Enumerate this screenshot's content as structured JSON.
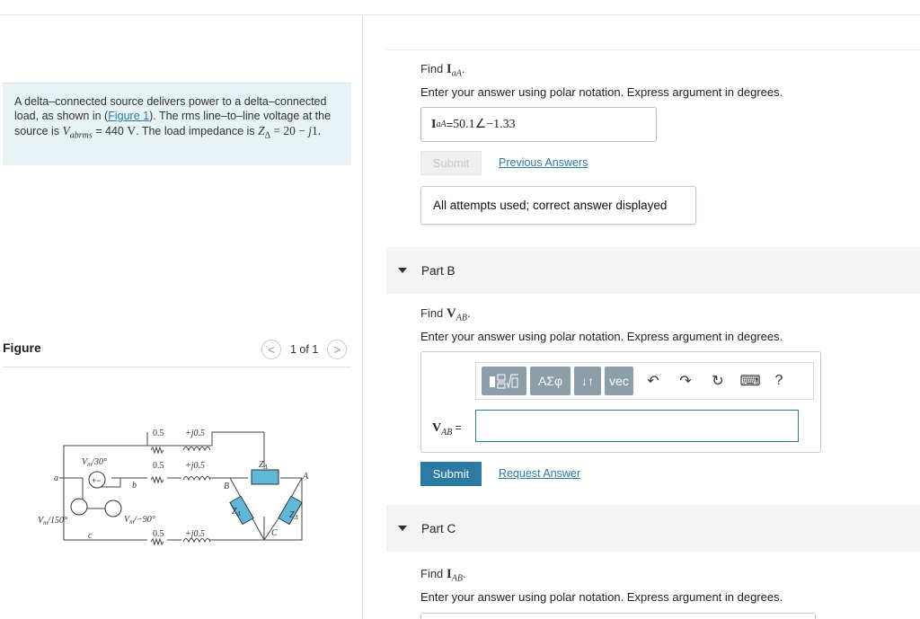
{
  "problem": {
    "text_1": "A delta–connected source delivers power to a delta–connected load, as shown in (",
    "figure_link": "Figure 1",
    "text_2": "). The rms line–to–line voltage at the source is ",
    "v_sym": "V",
    "v_sub": "abrms",
    "v_val": " = 440 ",
    "v_unit": "V",
    "text_3": ". The load impedance is ",
    "z_sym": "Z",
    "z_sub": "Δ",
    "z_eq": " = 20 − ",
    "z_j": "j",
    "z_end": "1."
  },
  "figure": {
    "title": "Figure",
    "pager": "1 of 1",
    "prev": "<",
    "next": ">",
    "circuit": {
      "r1": "0.5",
      "l1": "+j0.5",
      "r2": "0.5",
      "l2": "+j0.5",
      "r3": "0.5",
      "l3": "+j0.5",
      "vab": "V",
      "vab_sub": "m",
      "vab_ang": "/30°",
      "vca": "V",
      "vca_sub": "m",
      "vca_ang": "/150°",
      "vbc": "V",
      "vbc_sub": "m",
      "vbc_ang": "/−90°",
      "node_a": "a",
      "node_b": "b",
      "node_c": "c",
      "node_A": "A",
      "node_B": "B",
      "node_C": "C",
      "z": "Z",
      "z_sub": "Δ"
    }
  },
  "part_a": {
    "find_prefix": "Find ",
    "find_sym": "I",
    "find_sub": "aA",
    "find_dot": ".",
    "instruction": "Enter your answer using polar notation. Express argument in degrees.",
    "answer_sym": "I",
    "answer_sub": "aA",
    "answer_eq": " = ",
    "answer_value": "50.1∠−1.33",
    "submit_label": "Submit",
    "previous_answers": "Previous Answers",
    "status": "All attempts used; correct answer displayed"
  },
  "part_b": {
    "header": "Part B",
    "find_prefix": "Find ",
    "find_sym": "V",
    "find_sub": "AB",
    "find_dot": ".",
    "instruction": "Enter your answer using polar notation. Express argument in degrees.",
    "input_sym": "V",
    "input_sub": "AB",
    "input_eq": " =",
    "toolbar": {
      "templates_icon": "templates-icon",
      "greek_label": "ΑΣφ",
      "arrows_label": "↓↑",
      "vec_label": "vec",
      "undo_icon": "↶",
      "redo_icon": "↷",
      "reset_icon": "↻",
      "keyboard_icon": "⌨",
      "help_label": "?"
    },
    "submit_label": "Submit",
    "request_answer": "Request Answer"
  },
  "part_c": {
    "header": "Part C",
    "find_prefix": "Find ",
    "find_sym": "I",
    "find_sub": "AB",
    "find_dot": ".",
    "instruction": "Enter your answer using polar notation. Express argument in degrees."
  },
  "colors": {
    "accent": "#2a7aa3",
    "problem_bg": "#e8f3f6",
    "toolbar_button": "#8c9ea8",
    "part_header_bg": "#f4f4f4",
    "circuit_blue": "#5fb8d8"
  }
}
